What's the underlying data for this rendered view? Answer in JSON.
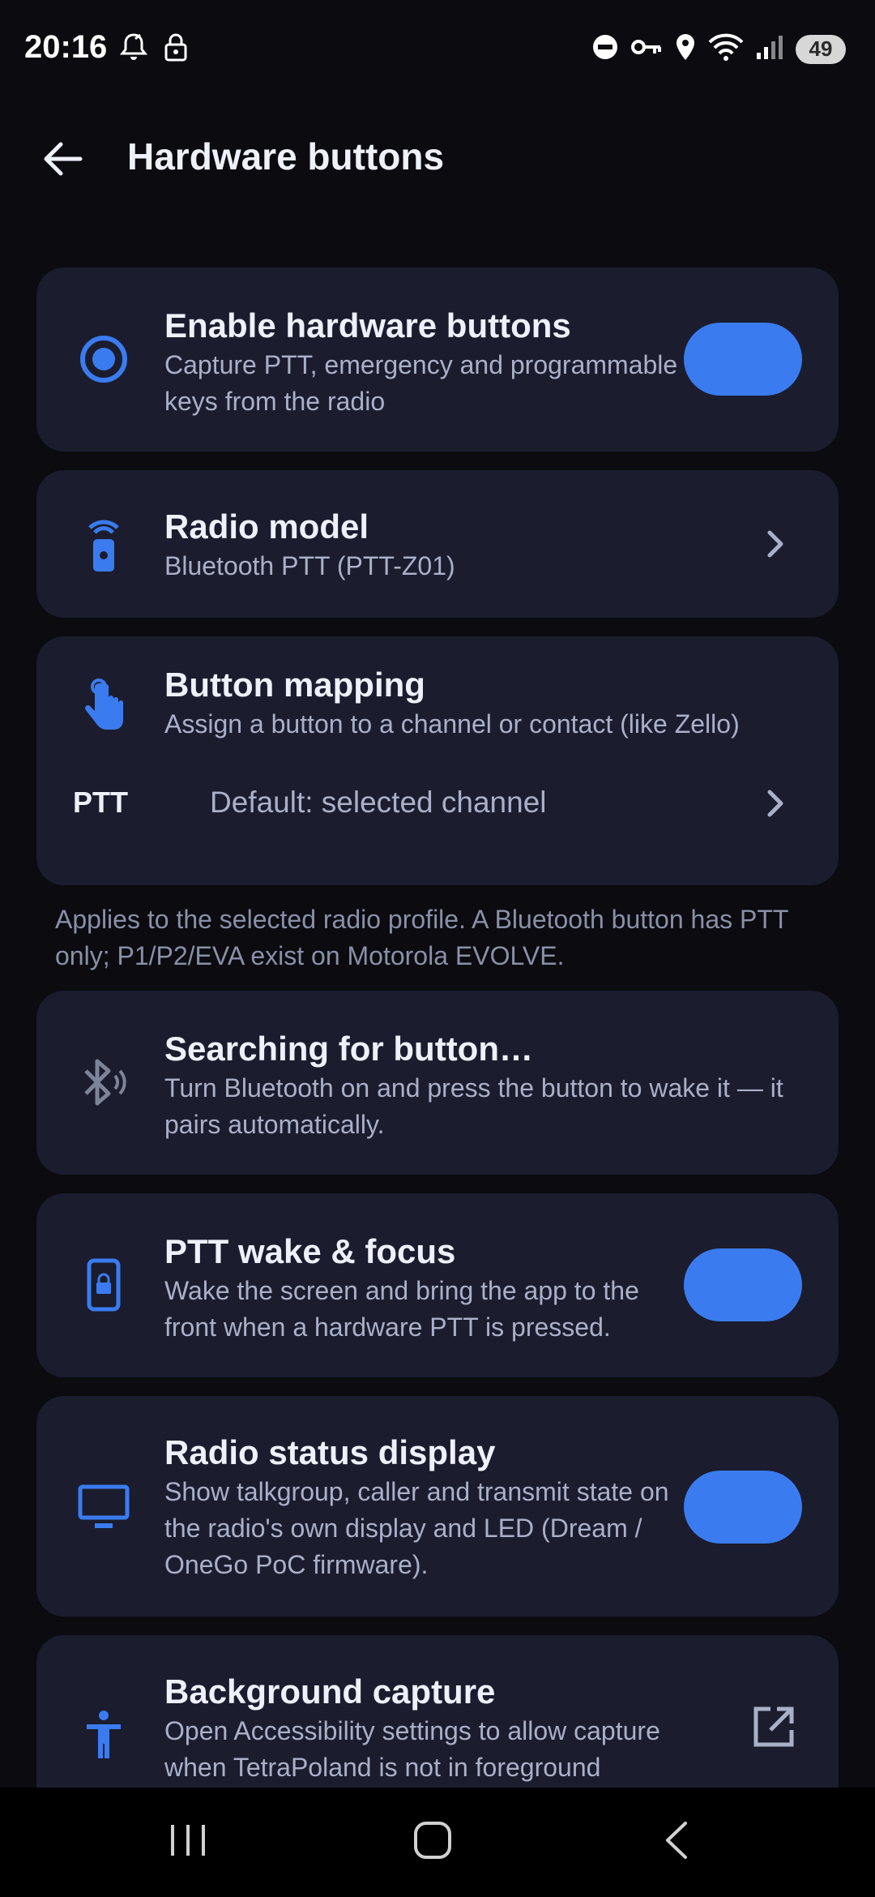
{
  "status_bar": {
    "time": "20:16",
    "battery": "49",
    "left_icons": [
      "notification-bell-icon",
      "lock-icon"
    ],
    "right_icons": [
      "do-not-disturb-icon",
      "vpn-key-icon",
      "location-icon",
      "wifi-icon",
      "signal-icon"
    ]
  },
  "app_bar": {
    "title": "Hardware buttons"
  },
  "cards": {
    "enable": {
      "title": "Enable hardware buttons",
      "subtitle": "Capture PTT, emergency and programmable keys from the radio",
      "toggle_on": true
    },
    "radio_model": {
      "title": "Radio model",
      "subtitle": "Bluetooth PTT (PTT-Z01)"
    },
    "button_mapping": {
      "title": "Button mapping",
      "subtitle": "Assign a button to a channel or contact (like Zello)",
      "rows": [
        {
          "key": "PTT",
          "value": "Default: selected channel"
        }
      ]
    },
    "searching": {
      "title": "Searching for button…",
      "subtitle": "Turn Bluetooth on and press the button to wake it — it pairs automatically."
    },
    "ptt_wake": {
      "title": "PTT wake & focus",
      "subtitle": "Wake the screen and bring the app to the front when a hardware PTT is pressed.",
      "toggle_on": true
    },
    "radio_status": {
      "title": "Radio status display",
      "subtitle": "Show talkgroup, caller and transmit state on the radio's own display and LED (Dream / OneGo PoC firmware).",
      "toggle_on": true
    },
    "background_capture": {
      "title": "Background capture",
      "subtitle": "Open Accessibility settings to allow capture when TetraPoland is not in foreground"
    }
  },
  "note": "Applies to the selected radio profile. A Bluetooth button has PTT only; P1/P2/EVA exist on Motorola EVOLVE.",
  "colors": {
    "accent": "#3a7cf0",
    "card_bg": "#1b1c2e",
    "page_bg": "#0b0b10",
    "muted_text": "#aab0c8"
  },
  "nav_bar": {
    "buttons": [
      "recents-icon",
      "home-icon",
      "back-icon"
    ]
  }
}
